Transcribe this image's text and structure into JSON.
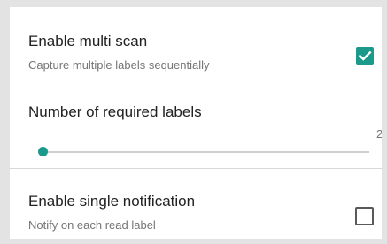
{
  "settings": {
    "multi_scan": {
      "title": "Enable multi scan",
      "summary": "Capture multiple labels sequentially",
      "checked": true
    },
    "required_labels": {
      "title": "Number of required labels",
      "value": "2",
      "min": 2,
      "current": 2
    },
    "single_notification": {
      "title": "Enable single notification",
      "summary": "Notify on each read label",
      "checked": false
    }
  },
  "colors": {
    "accent": "#1b9a8b",
    "title_text": "#212121",
    "summary_text": "#757575",
    "divider": "#d8d8d8"
  },
  "icons": {
    "checkbox_checked": "check-icon",
    "checkbox_unchecked": "checkbox-empty-icon"
  }
}
